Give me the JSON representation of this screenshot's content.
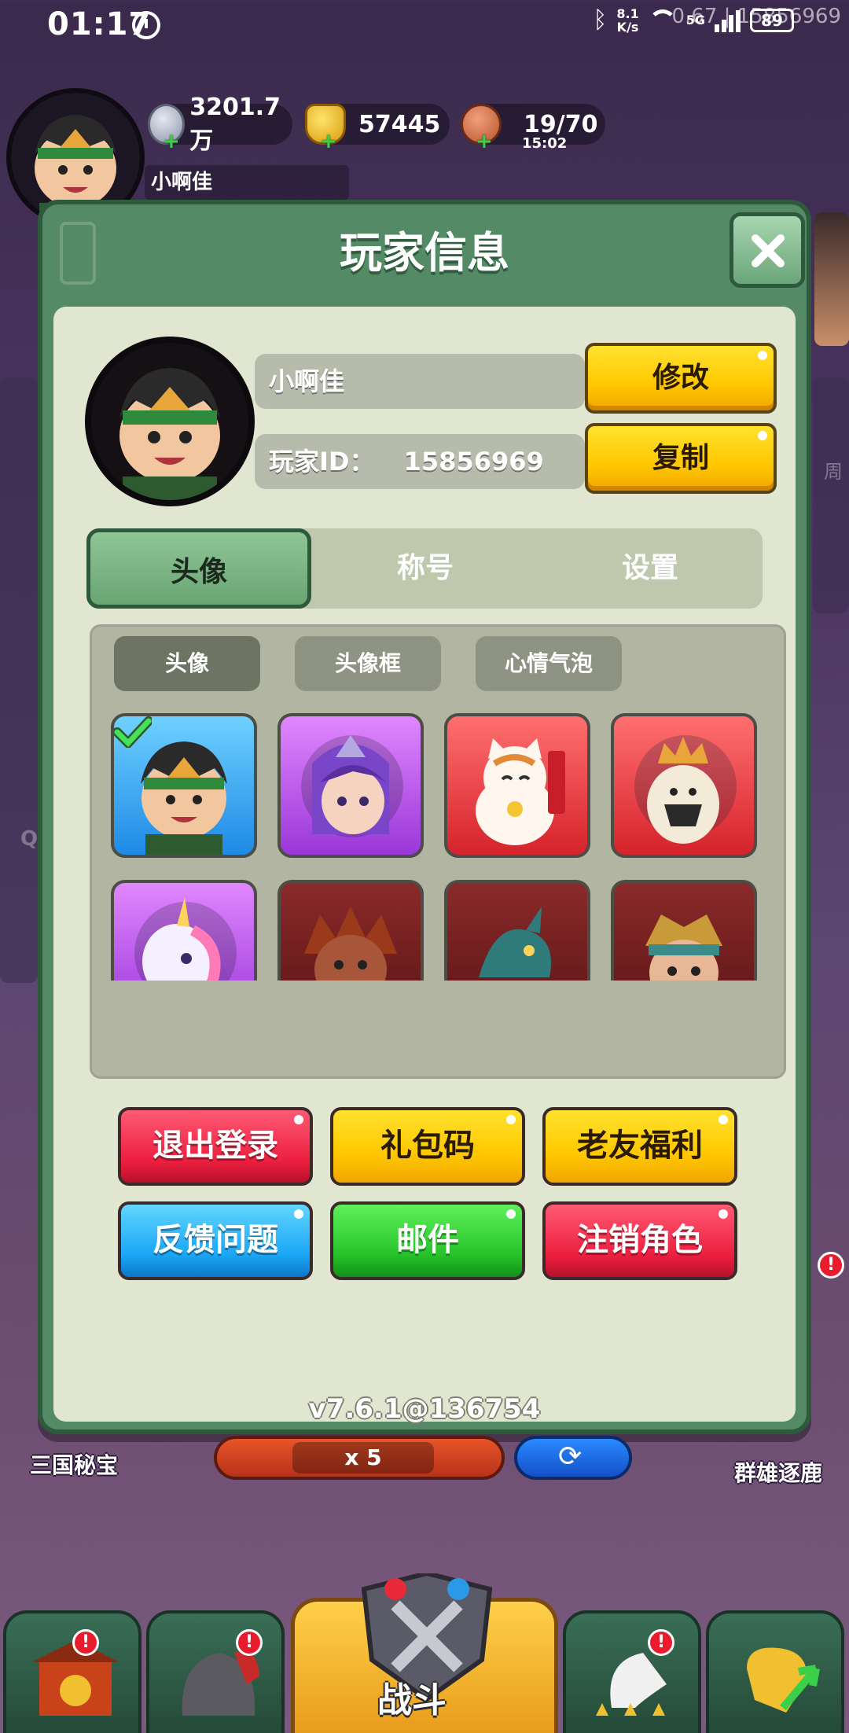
{
  "status_bar": {
    "time": "01:17",
    "net_speed_value": "8.1",
    "net_speed_unit": "K/s",
    "network": "5G",
    "battery": "89",
    "overlay_text": "0.67 | 15856969"
  },
  "top_bar": {
    "player_name": "小啊佳",
    "silver": "3201.7万",
    "gold": "57445",
    "stamina": "19/70",
    "stamina_timer": "15:02"
  },
  "dialog": {
    "title": "玩家信息",
    "close_icon": "close-icon",
    "name_value": "小啊佳",
    "id_label": "玩家ID：",
    "id_value": "15856969",
    "modify_label": "修改",
    "copy_label": "复制",
    "tabs": [
      {
        "label": "头像",
        "active": true
      },
      {
        "label": "称号",
        "active": false
      },
      {
        "label": "设置",
        "active": false
      }
    ],
    "subtabs": [
      {
        "label": "头像",
        "active": true
      },
      {
        "label": "头像框",
        "active": false
      },
      {
        "label": "心情气泡",
        "active": false
      }
    ],
    "avatars": [
      {
        "icon": "warrior-avatar-icon",
        "color": "blue",
        "selected": true
      },
      {
        "icon": "mage-girl-avatar-icon",
        "color": "purple",
        "selected": false
      },
      {
        "icon": "lucky-cat-avatar-icon",
        "color": "red",
        "selected": false
      },
      {
        "icon": "alpaca-king-avatar-icon",
        "color": "red",
        "selected": false
      },
      {
        "icon": "unicorn-avatar-icon",
        "color": "purple",
        "selected": false
      },
      {
        "icon": "lion-warrior-avatar-icon",
        "color": "darkred",
        "selected": false
      },
      {
        "icon": "dragon-avatar-icon",
        "color": "darkred",
        "selected": false
      },
      {
        "icon": "general-avatar-icon",
        "color": "darkred",
        "selected": false
      }
    ],
    "buttons": [
      {
        "label": "退出登录",
        "color": "red"
      },
      {
        "label": "礼包码",
        "color": "yellow"
      },
      {
        "label": "老友福利",
        "color": "yellow"
      },
      {
        "label": "反馈问题",
        "color": "blue"
      },
      {
        "label": "邮件",
        "color": "green"
      },
      {
        "label": "注销角色",
        "color": "red"
      }
    ],
    "version": "v7.6.1@136754"
  },
  "background": {
    "left_label": "三国秘宝",
    "right_label": "群雄逐鹿",
    "cost": "x 5",
    "battle_label": "战斗",
    "left_edge_letter": "Q",
    "right_edge_char": "周"
  },
  "colors": {
    "dialog_green": "#558a66",
    "panel_bg": "#e0e6cf",
    "accent_yellow": "#ffc800",
    "accent_red": "#ec1f3f"
  }
}
